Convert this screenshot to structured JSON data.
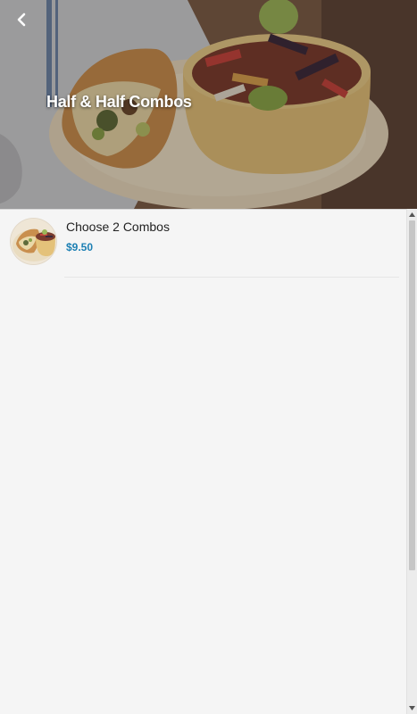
{
  "header": {
    "title": "Half & Half Combos",
    "back_icon": "chevron-left-icon"
  },
  "items": [
    {
      "name": "Choose 2 Combos",
      "price": "$9.50",
      "thumb_icon": "food-thumbnail"
    }
  ],
  "colors": {
    "price": "#1b7fb3",
    "background": "#f5f5f5",
    "title_text": "#ffffff"
  }
}
